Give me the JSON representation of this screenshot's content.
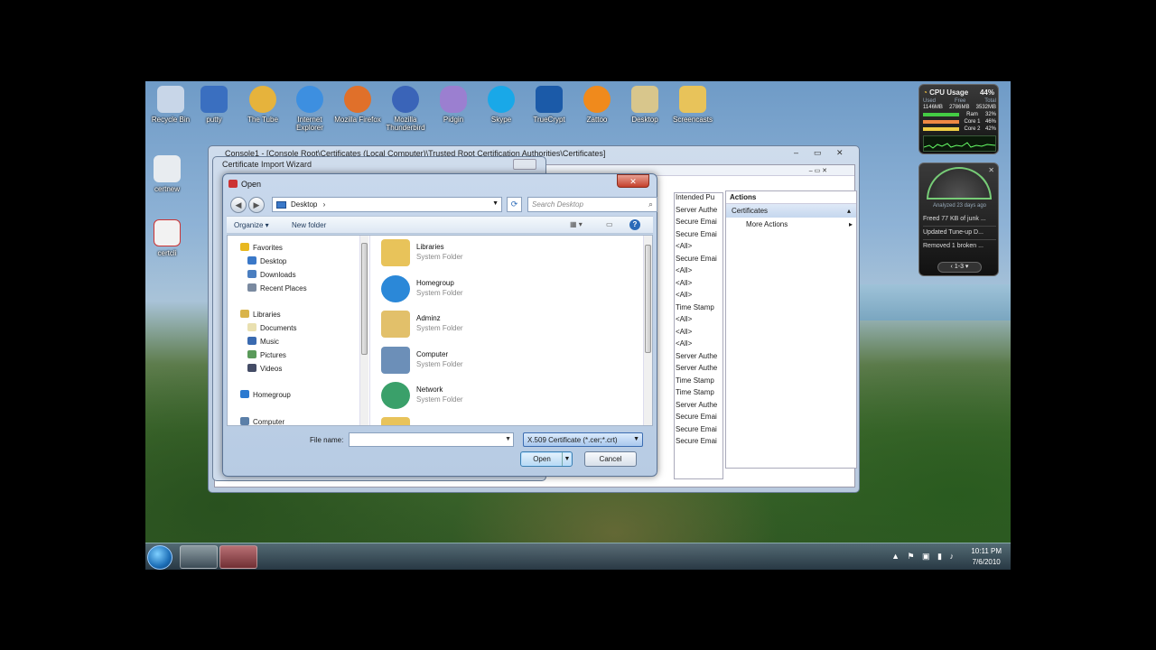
{
  "desktop": {
    "icons": [
      {
        "label": "Recycle Bin",
        "color": "#c8d6e8"
      },
      {
        "label": "putty",
        "color": "#3a6fc0"
      },
      {
        "label": "The Tube",
        "color": "#e6b33c"
      },
      {
        "label": "Internet Explorer",
        "color": "#3d8fe0"
      },
      {
        "label": "Mozilla Firefox",
        "color": "#e0702a"
      },
      {
        "label": "Mozilla Thunderbird",
        "color": "#3a64b8"
      },
      {
        "label": "Pidgin",
        "color": "#9b7fd0"
      },
      {
        "label": "Skype",
        "color": "#19a8e8"
      },
      {
        "label": "TrueCrypt",
        "color": "#1b5aa8"
      },
      {
        "label": "Zattoo",
        "color": "#f08a1c"
      },
      {
        "label": "Desktop",
        "color": "#d8c68c"
      },
      {
        "label": "Screencasts",
        "color": "#e8c35a"
      },
      {
        "label": "certnew",
        "color": "#e8ecf0"
      },
      {
        "label": "certcli",
        "color": "#f2f2f2"
      }
    ]
  },
  "gadget_cpu": {
    "title": "CPU Usage",
    "percent": "44%",
    "headers": [
      "Used",
      "Free",
      "Total"
    ],
    "mem": [
      "1146MB",
      "2786MB",
      "3532MB"
    ],
    "ram_label": "Ram",
    "ram_pct": "32%",
    "core1_label": "Core 1",
    "core1_pct": "46%",
    "core2_label": "Core 2",
    "core2_pct": "42%"
  },
  "gadget_tuneup": {
    "analyzed": "Analyzed 23 days ago",
    "items": [
      "Freed 77 KB of junk ...",
      "Updated Tune-up D...",
      "Removed 1 broken ..."
    ],
    "pager": "1-3"
  },
  "mmc": {
    "title": "Console1 - [Console Root\\Certificates (Local Computer)\\Trusted Root Certification Authorities\\Certificates]",
    "column_header": "Intended Pu",
    "column_values": [
      "Server Authe",
      "Secure Emai",
      "Secure Emai",
      "<All>",
      "Secure Emai",
      "<All>",
      "<All>",
      "<All>",
      "Time Stamp",
      "<All>",
      "<All>",
      "<All>",
      "Server Authe",
      "Server Authe",
      "Time Stamp",
      "Time Stamp",
      "Server Authe",
      "Secure Emai",
      "Secure Emai",
      "Secure Emai"
    ],
    "actions_header": "Actions",
    "actions_selected": "Certificates",
    "actions_more": "More Actions"
  },
  "wizard": {
    "title": "Certificate Import Wizard"
  },
  "open_dialog": {
    "title": "Open",
    "close_label": "✕",
    "address": "Desktop",
    "search_placeholder": "Search Desktop",
    "toolbar": {
      "organize": "Organize ▾",
      "new_folder": "New folder"
    },
    "nav": [
      {
        "label": "Favorites",
        "group": true,
        "color": "#e8b820"
      },
      {
        "label": "Desktop",
        "group": false,
        "color": "#3a78c8"
      },
      {
        "label": "Downloads",
        "group": false,
        "color": "#4a7ec0"
      },
      {
        "label": "Recent Places",
        "group": false,
        "color": "#7a8aa0"
      },
      {
        "label": "Libraries",
        "group": true,
        "color": "#d9b44a"
      },
      {
        "label": "Documents",
        "group": false,
        "color": "#e9e0b0"
      },
      {
        "label": "Music",
        "group": false,
        "color": "#3a6ab0"
      },
      {
        "label": "Pictures",
        "group": false,
        "color": "#5a9a5a"
      },
      {
        "label": "Videos",
        "group": false,
        "color": "#444c66"
      },
      {
        "label": "Homegroup",
        "group": true,
        "color": "#2b7ad0"
      },
      {
        "label": "Computer",
        "group": true,
        "color": "#5b7fa8"
      }
    ],
    "files": [
      {
        "name": "Libraries",
        "type": "System Folder",
        "color": "#e8c35a"
      },
      {
        "name": "Homegroup",
        "type": "System Folder",
        "color": "#2b88d8"
      },
      {
        "name": "Adminz",
        "type": "System Folder",
        "color": "#e2c06a"
      },
      {
        "name": "Computer",
        "type": "System Folder",
        "color": "#6c8fb8"
      },
      {
        "name": "Network",
        "type": "System Folder",
        "color": "#3aa06a"
      }
    ],
    "file_name_label": "File name:",
    "file_name_value": "",
    "filter": "X.509 Certificate (*.cer;*.crt)",
    "open_label": "Open",
    "cancel_label": "Cancel"
  },
  "taskbar": {
    "time": "10:11 PM",
    "date": "7/6/2010"
  }
}
